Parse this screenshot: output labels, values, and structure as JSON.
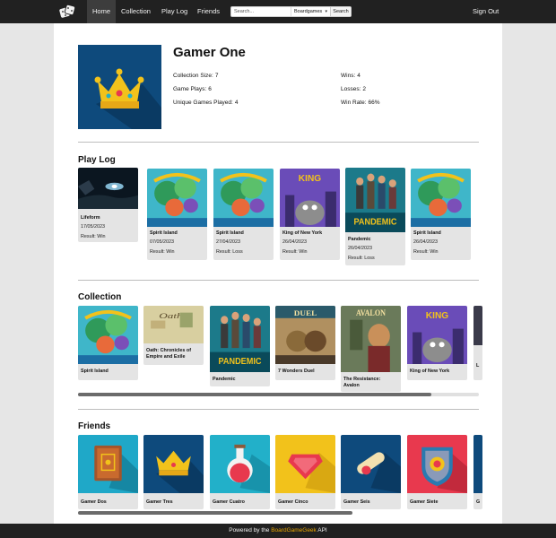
{
  "navbar": {
    "items": [
      "Home",
      "Collection",
      "Play Log",
      "Friends"
    ],
    "search_placeholder": "Search...",
    "search_type": "Boardgames",
    "search_button": "Search",
    "signout": "Sign Out"
  },
  "profile": {
    "name": "Gamer One",
    "stats": {
      "collection_label": "Collection Size:",
      "collection_value": "7",
      "plays_label": "Game Plays:",
      "plays_value": "6",
      "unique_label": "Unique Games Played:",
      "unique_value": "4",
      "wins_label": "Wins:",
      "wins_value": "4",
      "losses_label": "Losses:",
      "losses_value": "2",
      "winrate_label": "Win Rate:",
      "winrate_value": "66%"
    }
  },
  "playlog": {
    "title": "Play Log",
    "entries": [
      {
        "name": "Lifeform",
        "date": "17/05/2023",
        "result": "Result: Win",
        "cover": "lifeform"
      },
      {
        "name": "Spirit Island",
        "date": "07/05/2023",
        "result": "Result: Win",
        "cover": "spirit"
      },
      {
        "name": "Spirit Island",
        "date": "27/04/2023",
        "result": "Result: Loss",
        "cover": "spirit"
      },
      {
        "name": "King of New York",
        "date": "26/04/2023",
        "result": "Result: Win",
        "cover": "king"
      },
      {
        "name": "Pandemic",
        "date": "26/04/2023",
        "result": "Result: Loss",
        "cover": "pandemic"
      },
      {
        "name": "Spirit Island",
        "date": "26/04/2023",
        "result": "Result: Win",
        "cover": "spirit"
      }
    ]
  },
  "collection": {
    "title": "Collection",
    "items": [
      {
        "name": "Spirit Island",
        "cover": "spirit"
      },
      {
        "name": "Oath: Chronicles of Empire and Exile",
        "cover": "oath"
      },
      {
        "name": "Pandemic",
        "cover": "pandemic"
      },
      {
        "name": "7 Wonders Duel",
        "cover": "duel"
      },
      {
        "name": "The Resistance: Avalon",
        "cover": "avalon"
      },
      {
        "name": "King of New York",
        "cover": "king"
      }
    ],
    "partial_label": "L"
  },
  "friends": {
    "title": "Friends",
    "items": [
      {
        "name": "Gamer Dos",
        "icon": "book-icon",
        "color": "#1fa8c8"
      },
      {
        "name": "Gamer Tres",
        "icon": "crown-icon",
        "color": "#0e4a7c"
      },
      {
        "name": "Gamer Cuatro",
        "icon": "potion-icon",
        "color": "#22b0c9"
      },
      {
        "name": "Gamer Cinco",
        "icon": "gem-icon",
        "color": "#f2c21b"
      },
      {
        "name": "Gamer Seis",
        "icon": "scroll-icon",
        "color": "#0e4a7c"
      },
      {
        "name": "Gamer Siete",
        "icon": "shield-icon",
        "color": "#e8394e"
      }
    ],
    "partial_label": "G"
  },
  "footer": {
    "prefix": "Powered by the ",
    "link": "BoardGameGeek",
    "suffix": " API"
  },
  "colors": {
    "navbar": "#212121",
    "footer_link": "#e7a400",
    "profile_bg": "#0e4a7c",
    "crown": "#f2c21b"
  }
}
